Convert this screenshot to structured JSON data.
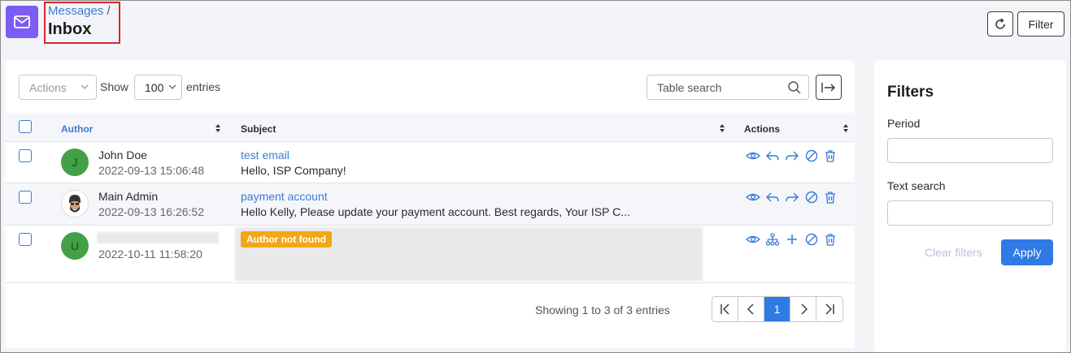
{
  "header": {
    "breadcrumb": "Messages",
    "breadcrumb_sep": "/",
    "title": "Inbox",
    "filter_label": "Filter"
  },
  "toolbar": {
    "actions_placeholder": "Actions",
    "show_label": "Show",
    "entries_value": "100",
    "entries_label": "entries",
    "search_placeholder": "Table search"
  },
  "table": {
    "columns": [
      "Author",
      "Subject",
      "Actions"
    ],
    "rows": [
      {
        "avatar_initial": "J",
        "author": "John Doe",
        "date": "2022-09-13 15:06:48",
        "subject": "test email",
        "body": "Hello, ISP Company!",
        "actions": [
          "eye-icon",
          "reply-icon",
          "forward-icon",
          "block-icon",
          "trash-icon"
        ]
      },
      {
        "avatar_initial": "",
        "author": "Main Admin",
        "date": "2022-09-13 16:26:52",
        "subject": "payment account",
        "body": "Hello Kelly,  Please update your payment account.  Best regards, Your ISP C...",
        "actions": [
          "eye-icon",
          "reply-icon",
          "forward-icon",
          "block-icon",
          "trash-icon"
        ]
      },
      {
        "avatar_initial": "U",
        "author": "",
        "date": "2022-10-11 11:58:20",
        "badge": "Author not found",
        "subject": "",
        "body": "",
        "actions": [
          "eye-icon",
          "hierarchy-icon",
          "plus-icon",
          "block-icon",
          "trash-icon"
        ]
      }
    ]
  },
  "pagination": {
    "showing": "Showing 1 to 3 of 3 entries",
    "current_page": "1"
  },
  "filters": {
    "title": "Filters",
    "period_label": "Period",
    "text_search_label": "Text search",
    "clear_label": "Clear filters",
    "apply_label": "Apply"
  },
  "colors": {
    "accent": "#2f7ae5",
    "link": "#3a7bd5",
    "app_icon": "#7c5cf5",
    "badge": "#f3a716",
    "avatar": "#43a047",
    "highlight_box": "#d9262c"
  }
}
